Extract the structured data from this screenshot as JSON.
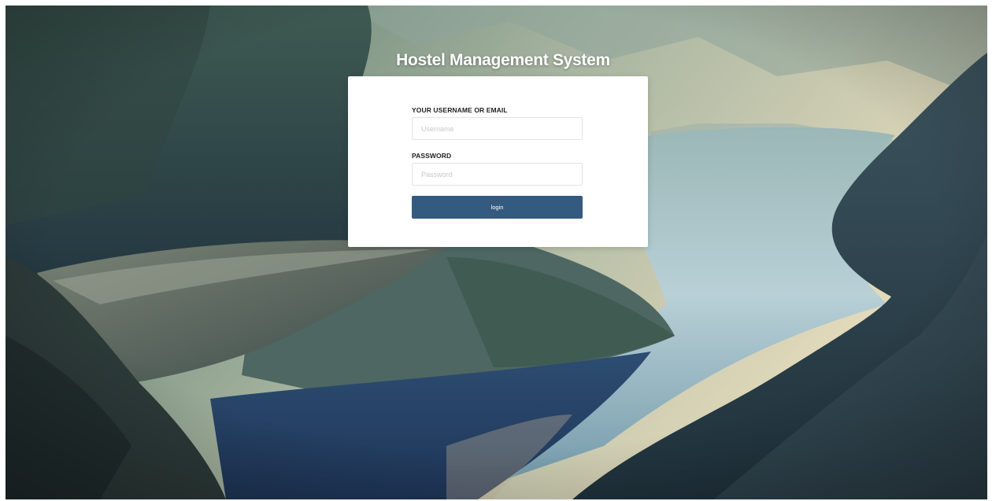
{
  "page": {
    "title": "Hostel Management System"
  },
  "login_form": {
    "username_label": "YOUR USERNAME OR EMAIL",
    "username_placeholder": "Username",
    "username_value": "",
    "password_label": "PASSWORD",
    "password_placeholder": "Password",
    "password_value": "",
    "login_button_label": "login"
  },
  "colors": {
    "button": "#355a80",
    "card": "#ffffff",
    "title": "#ffffff"
  }
}
